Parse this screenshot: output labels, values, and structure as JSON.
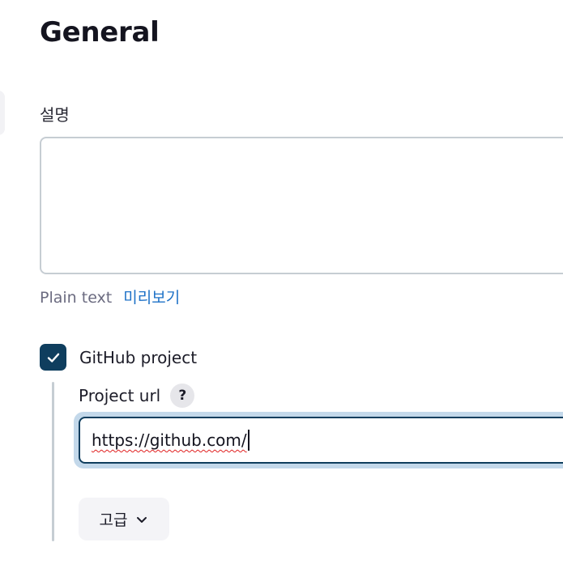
{
  "section": {
    "title": "General"
  },
  "description": {
    "label": "설명",
    "value": "",
    "format_text": "Plain text",
    "preview_link": "미리보기"
  },
  "github_project": {
    "checked": true,
    "label": "GitHub project",
    "url_label": "Project url",
    "help_symbol": "?",
    "url_value": "https://github.com/"
  },
  "advanced": {
    "label": "고급",
    "icon": "chevron-down-icon"
  },
  "colors": {
    "accent": "#0f3e5e",
    "link": "#1d71c7",
    "focus_ring": "#c3d8ea"
  }
}
